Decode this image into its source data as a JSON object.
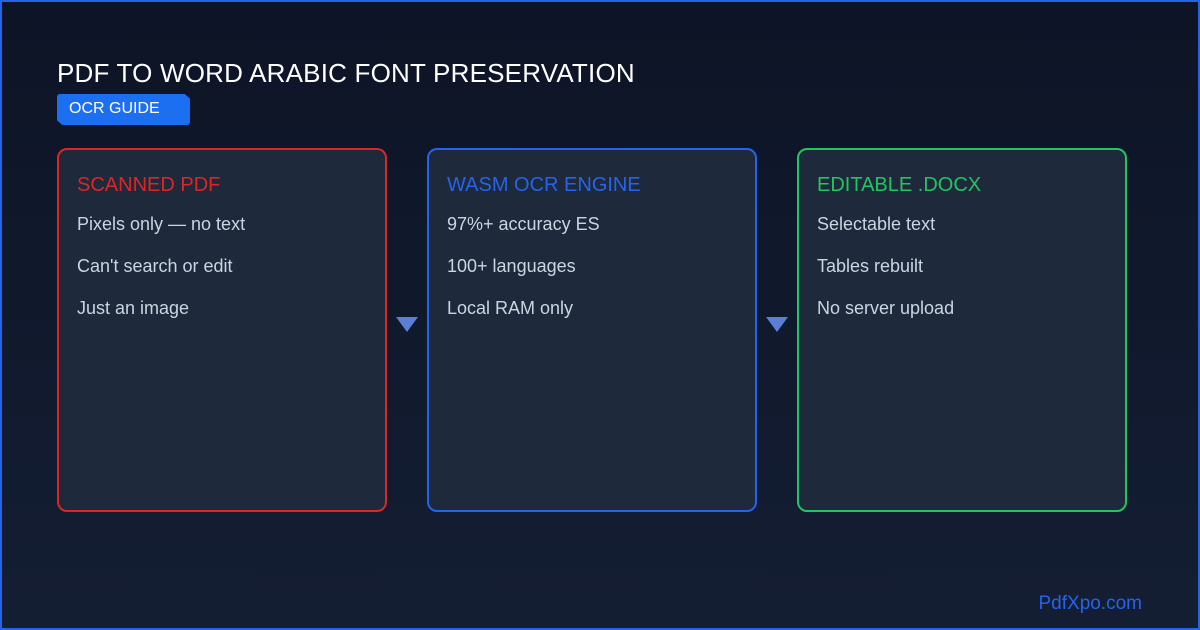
{
  "title": "PDF TO WORD ARABIC FONT PRESERVATION",
  "badge": "OCR GUIDE",
  "footer": "PdfXpo.com",
  "colors": {
    "background": "#0f172a",
    "frame": "#2563eb",
    "card_fill": "#1e293b",
    "badge": "#1d6ff2",
    "arrow": "#5b7fd4",
    "item_text": "#cbd5e1"
  },
  "cards": [
    {
      "title": "SCANNED PDF",
      "color": "#dc2626",
      "items": [
        "Pixels only — no text",
        "Can't search or edit",
        "Just an image"
      ]
    },
    {
      "title": "WASM OCR ENGINE",
      "color": "#2563eb",
      "items": [
        "97%+ accuracy ES",
        "100+ languages",
        "Local RAM only"
      ]
    },
    {
      "title": "EDITABLE .DOCX",
      "color": "#22c55e",
      "items": [
        "Selectable text",
        "Tables rebuilt",
        "No server upload"
      ]
    }
  ],
  "arrows": [
    {
      "icon": "triangle-down-icon"
    },
    {
      "icon": "triangle-down-icon"
    }
  ]
}
